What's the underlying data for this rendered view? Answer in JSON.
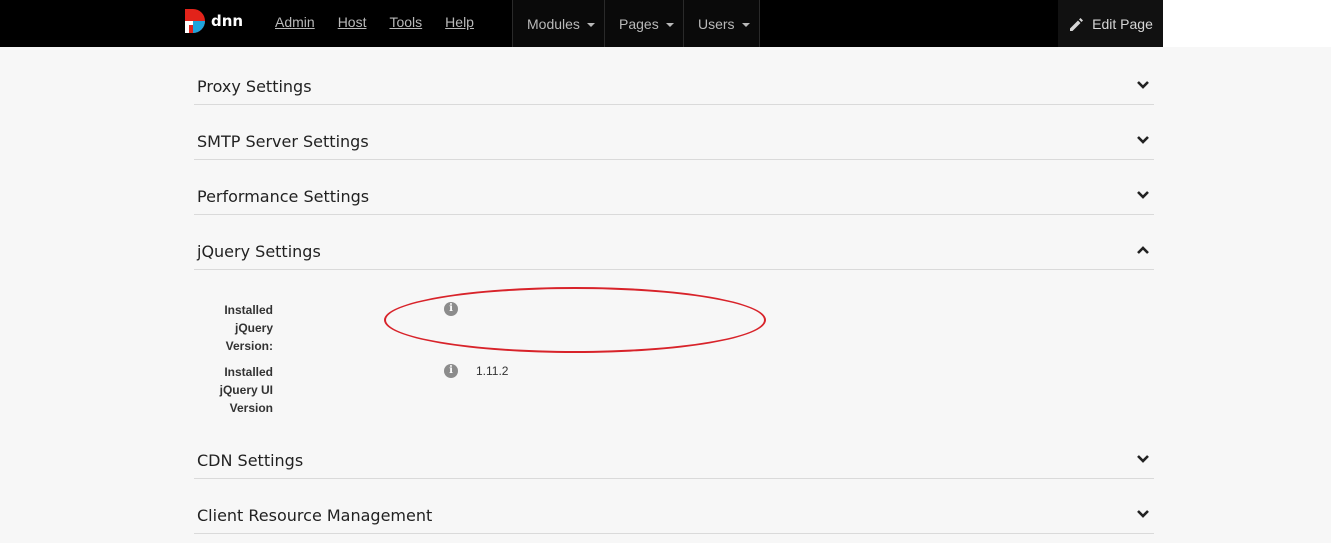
{
  "topbar": {
    "logo_text": "dnn",
    "links": [
      "Admin",
      "Host",
      "Tools",
      "Help"
    ],
    "menus": [
      "Modules",
      "Pages",
      "Users"
    ],
    "edit_page_label": "Edit Page"
  },
  "sections": {
    "proxy": "Proxy Settings",
    "smtp": "SMTP Server Settings",
    "performance": "Performance Settings",
    "jquery": "jQuery Settings",
    "cdn": "CDN Settings",
    "client_resource": "Client Resource Management"
  },
  "jquery_settings": {
    "installed_jquery_label": [
      "Installed",
      "jQuery",
      "Version:"
    ],
    "installed_jquery_value": "",
    "installed_jquery_ui_label": [
      "Installed",
      "jQuery UI",
      "Version"
    ],
    "installed_jquery_ui_value": "1.11.2"
  },
  "icons": {
    "info": "info-icon",
    "chevron_down": "chevron-down-icon",
    "chevron_up": "chevron-up-icon",
    "pencil": "pencil-icon"
  },
  "colors": {
    "topbar_bg": "#000000",
    "annotation": "#d8232a"
  }
}
